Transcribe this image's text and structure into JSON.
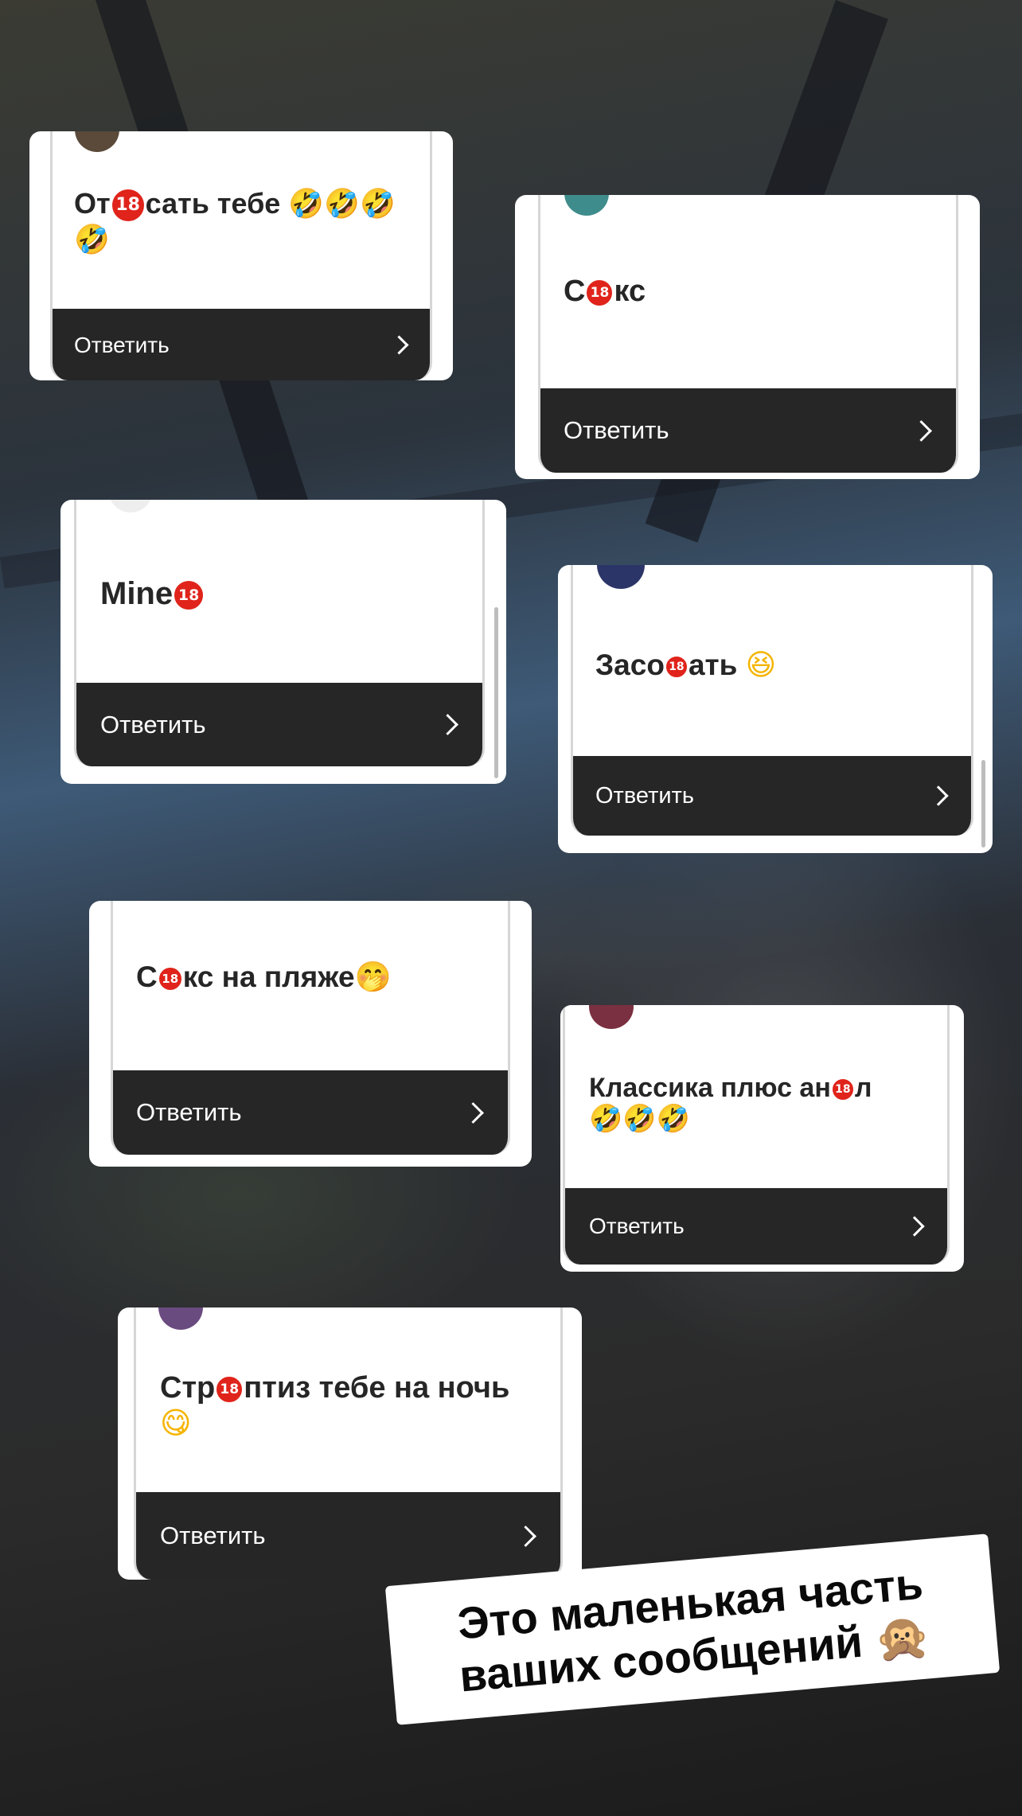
{
  "cards": [
    {
      "text_before": "От",
      "text_after": "сать тебе",
      "emoji": "🤣🤣🤣🤣",
      "reply_label": "Ответить"
    },
    {
      "text_before": "С",
      "text_after": "кс",
      "emoji": "",
      "reply_label": "Ответить"
    },
    {
      "text_before": "Mine",
      "text_after": "",
      "emoji": "",
      "reply_label": "Ответить"
    },
    {
      "text_before": "Засо",
      "text_after": "ать",
      "emoji": "😆",
      "reply_label": "Ответить"
    },
    {
      "text_before": "С",
      "text_after": "кс на пляже",
      "emoji": "🤭",
      "reply_label": "Ответить"
    },
    {
      "text_before": "Классика плюс ан",
      "text_after": "л",
      "emoji": "🤣🤣🤣",
      "reply_label": "Ответить"
    },
    {
      "text_before": "Стр",
      "text_after": "птиз тебе на ночь",
      "emoji": "😋",
      "reply_label": "Ответить"
    }
  ],
  "badge": "18",
  "caption": {
    "line1": "Это маленькая часть",
    "line2": "ваших сообщений",
    "emoji": "🙊"
  },
  "colors": {
    "reply_bar": "#262626",
    "badge": "#e0241b"
  }
}
